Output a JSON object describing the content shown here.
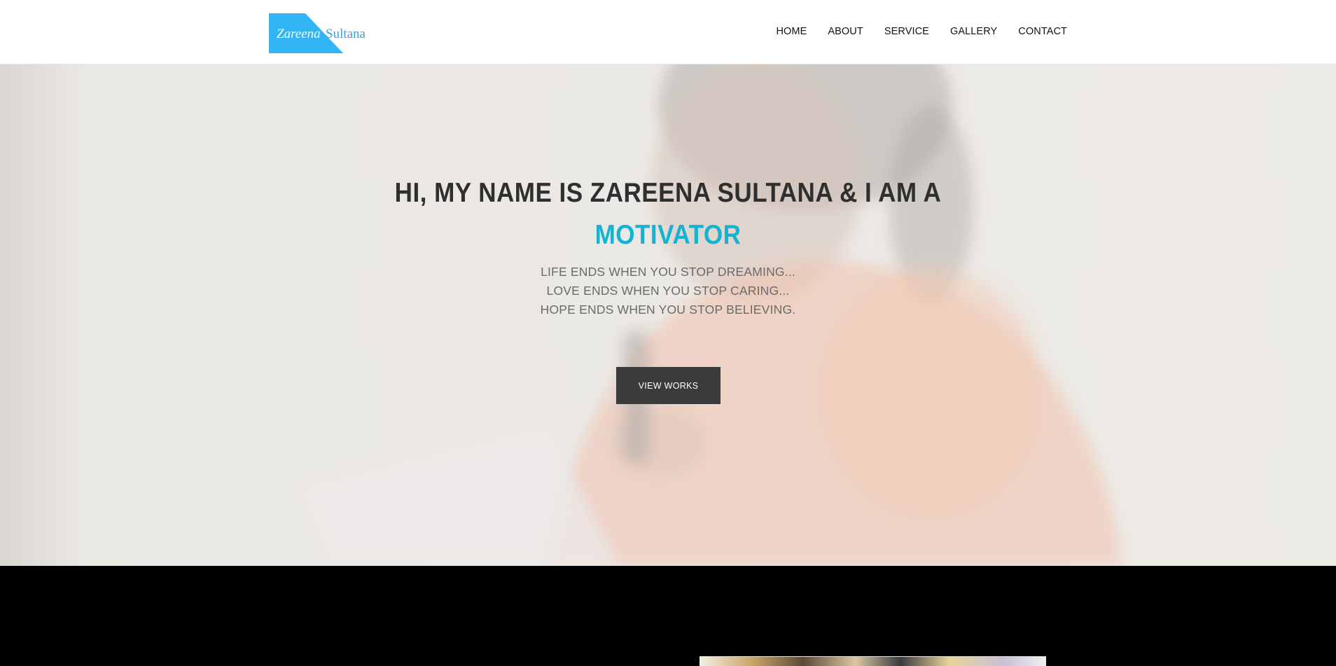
{
  "brand": {
    "first_name": "Zareena",
    "last_name": "Sultana",
    "logo_color": "#33b5f5"
  },
  "nav": {
    "items": [
      "HOME",
      "ABOUT",
      "SERVICE",
      "GALLERY",
      "CONTACT"
    ]
  },
  "hero": {
    "headline": "HI, MY NAME IS ZAREENA SULTANA & I AM A",
    "role": "MOTIVATOR",
    "quotes": [
      "LIFE ENDS WHEN YOU STOP DREAMING...",
      "LOVE ENDS WHEN YOU STOP CARING...",
      "HOPE ENDS WHEN YOU STOP BELIEVING."
    ],
    "cta_label": "VIEW WORKS",
    "accent_color": "#13b3d3"
  },
  "colors": {
    "header_bg": "#ffffff",
    "button_bg": "#3b3b3b",
    "dark_section_bg": "#000000"
  }
}
